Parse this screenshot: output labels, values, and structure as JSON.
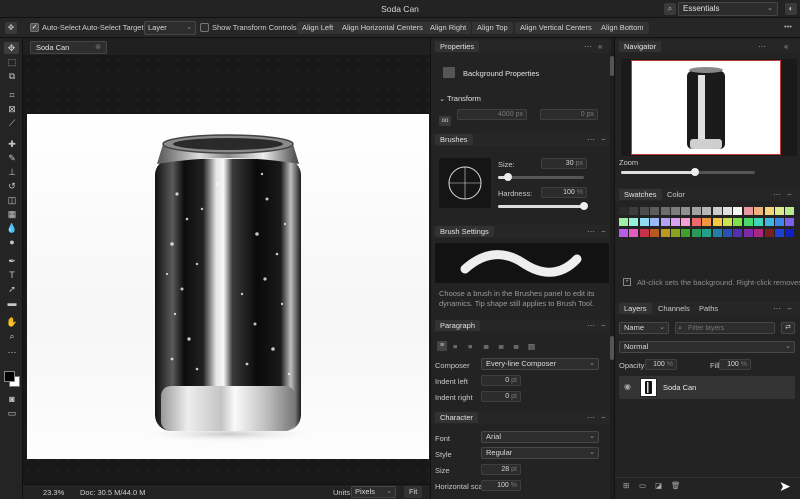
{
  "app": {
    "title": "Soda Can",
    "workspace": "Essentials"
  },
  "options": {
    "auto_select_label": "Auto-Select",
    "auto_select_target_label": "Auto-Select Target",
    "target_value": "Layer",
    "show_transform_label": "Show Transform Controls",
    "buttons": [
      "Align Left",
      "Align Horizontal Centers",
      "Align Right",
      "Align Top",
      "Align Vertical Centers",
      "Align Bottom"
    ],
    "more": "•••"
  },
  "document": {
    "tab": "Soda Can"
  },
  "status": {
    "zoom": "23.3%",
    "doc": "Doc: 30.5 M/44.0 M",
    "units_label": "Units",
    "units_value": "Pixels",
    "fit": "Fit"
  },
  "properties": {
    "tab": "Properties",
    "background": "Background Properties",
    "transform": "Transform",
    "w_value": "4000",
    "w_unit": "px",
    "x_value": "0",
    "x_unit": "px"
  },
  "brushes": {
    "tab": "Brushes",
    "size_label": "Size:",
    "size_value": "30",
    "size_unit": "px",
    "size_pct": 0.12,
    "hardness_label": "Hardness:",
    "hardness_value": "100",
    "hardness_unit": "%",
    "hardness_pct": 1.0
  },
  "brush_settings": {
    "tab": "Brush Settings",
    "help": "Choose a brush in the Brushes panel to edit its dynamics. Tip shape still applies to Brush Tool."
  },
  "paragraph": {
    "tab": "Paragraph",
    "composer_label": "Composer",
    "composer_value": "Every-line Composer",
    "indent_left_label": "Indent left",
    "indent_left_value": "0",
    "indent_left_unit": "pt",
    "indent_right_label": "Indent right",
    "indent_right_value": "0",
    "indent_right_unit": "pt"
  },
  "character": {
    "tab": "Character",
    "font_label": "Font",
    "font_value": "Arial",
    "style_label": "Style",
    "style_value": "Regular",
    "size_label": "Size",
    "size_value": "28",
    "size_unit": "pt",
    "hscale_label": "Horizontal scale",
    "hscale_value": "100",
    "hscale_unit": "%"
  },
  "navigator": {
    "tab": "Navigator",
    "zoom_label": "Zoom",
    "zoom_pct": 0.55
  },
  "swatches": {
    "tabs": [
      "Swatches",
      "Color"
    ],
    "hint": "Alt-click sets the background. Right-click removes.",
    "colors": [
      [
        "#2b2b2b",
        "#3c3c3c",
        "#4c4c4c",
        "#5c5c5c",
        "#6d6d6d",
        "#7e7e7e",
        "#909090",
        "#a3a3a3",
        "#b7b7b7",
        "#cccccc",
        "#e0e0e0",
        "#f5f5f5",
        "#e89aa0",
        "#f0b27a",
        "#f5d47a",
        "#dfe98f",
        "#b9ea8f"
      ],
      [
        "#9ef0a8",
        "#97f0d9",
        "#90dcf3",
        "#9cb9f5",
        "#b5a4f3",
        "#dda2ef",
        "#f5a0d4",
        "#ef6b6b",
        "#f0963f",
        "#f4c93f",
        "#cde24c",
        "#7fe04c",
        "#48d96d",
        "#3ed6b7",
        "#3eb7e4",
        "#3f86ec",
        "#7e5fec"
      ],
      [
        "#b85ce6",
        "#e55cbe",
        "#c8324a",
        "#b85a1f",
        "#b89a1f",
        "#8aa41f",
        "#3f9e2d",
        "#2a9a58",
        "#21a08a",
        "#217fa5",
        "#2850b5",
        "#5131b0",
        "#7d2aa8",
        "#a8287f",
        "#7a2020",
        "#2040d0",
        "#1020c0"
      ]
    ]
  },
  "layers": {
    "tabs": [
      "Layers",
      "Channels",
      "Paths"
    ],
    "filter_value": "Name",
    "filter_placeholder": "Filter layers",
    "blend": "Normal",
    "opacity_label": "Opacity",
    "opacity_value": "100",
    "opacity_unit": "%",
    "fill_label": "Fill",
    "fill_value": "100",
    "fill_unit": "%",
    "items": [
      {
        "name": "Soda Can"
      }
    ]
  }
}
